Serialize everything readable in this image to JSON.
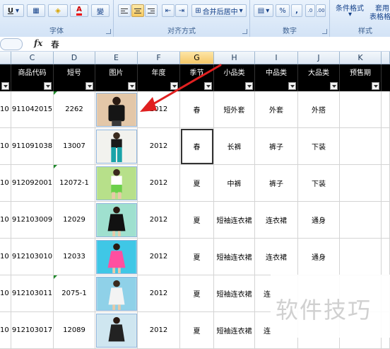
{
  "ribbon": {
    "font_group_label": "字体",
    "align_group_label": "对齐方式",
    "merge_label": "合并后居中",
    "number_group_label": "数字",
    "percent_label": "%",
    "comma_label": ",",
    "style_group_label": "样式",
    "cond_format_label": "条件格式",
    "table_format_label": "套用",
    "table_format_label2": "表格格式",
    "underline_label": "U",
    "font_color_label": "A",
    "wen_label": "變"
  },
  "formula_bar": {
    "fx_label": "fx",
    "value": "春"
  },
  "columns": [
    "C",
    "D",
    "E",
    "F",
    "G",
    "H",
    "I",
    "J",
    "K"
  ],
  "selected_column": "G",
  "headers": [
    "商品代码",
    "短号",
    "图片",
    "年度",
    "季节",
    "小品类",
    "中品类",
    "大品类",
    "预售期"
  ],
  "rows": [
    {
      "b": "10",
      "code": "911042015",
      "short": "2262",
      "year": "2012",
      "season": "春",
      "small": "短外套",
      "mid": "外套",
      "big": "外搭"
    },
    {
      "b": "10",
      "code": "911091038",
      "short": "13007",
      "year": "2012",
      "season": "春",
      "small": "长裤",
      "mid": "裤子",
      "big": "下装"
    },
    {
      "b": "10",
      "code": "912092001",
      "short": "12072-1",
      "year": "2012",
      "season": "夏",
      "small": "中裤",
      "mid": "裤子",
      "big": "下装"
    },
    {
      "b": "10",
      "code": "912103009",
      "short": "12029",
      "year": "2012",
      "season": "夏",
      "small": "短袖连衣裙",
      "mid": "连衣裙",
      "big": "通身"
    },
    {
      "b": "10",
      "code": "912103010",
      "short": "12033",
      "year": "2012",
      "season": "夏",
      "small": "短袖连衣裙",
      "mid": "连衣裙",
      "big": "通身"
    },
    {
      "b": "10",
      "code": "912103011",
      "short": "2075-1",
      "year": "2012",
      "season": "夏",
      "small": "短袖连衣裙",
      "mid": "连",
      "big": ""
    },
    {
      "b": "10",
      "code": "912103017",
      "short": "12089",
      "year": "2012",
      "season": "夏",
      "small": "短袖连衣裙",
      "mid": "连",
      "big": ""
    }
  ],
  "watermark": "软件技巧",
  "colors": {
    "header_bg": "#000000",
    "selected_col": "#f5c767",
    "arrow": "#e02020"
  }
}
